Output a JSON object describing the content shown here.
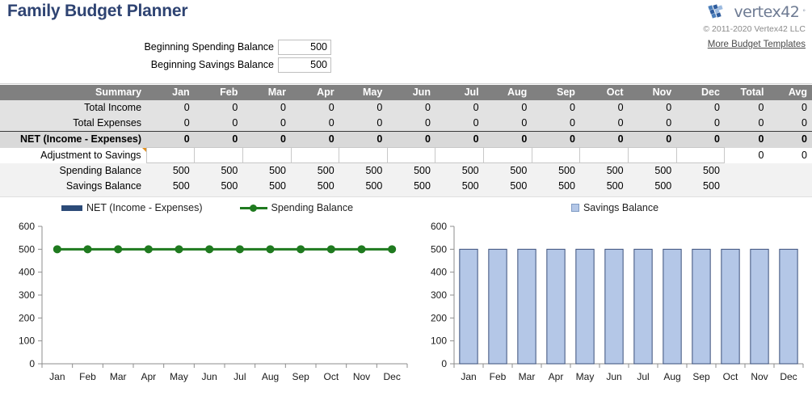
{
  "header": {
    "title": "Family Budget Planner",
    "brand_name": "vertex42",
    "brand_sup": "°",
    "logo_icon": "vertex42-logo-icon",
    "copyright": "© 2011-2020 Vertex42 LLC",
    "more_templates_link": "More Budget Templates"
  },
  "balances": {
    "rows": [
      {
        "label": "Beginning Spending Balance",
        "value": "500"
      },
      {
        "label": "Beginning Savings Balance",
        "value": "500"
      }
    ]
  },
  "summary": {
    "columns": [
      "Summary",
      "Jan",
      "Feb",
      "Mar",
      "Apr",
      "May",
      "Jun",
      "Jul",
      "Aug",
      "Sep",
      "Oct",
      "Nov",
      "Dec",
      "Total",
      "Avg"
    ],
    "rows": [
      {
        "label": "Total Income",
        "values": [
          "0",
          "0",
          "0",
          "0",
          "0",
          "0",
          "0",
          "0",
          "0",
          "0",
          "0",
          "0"
        ],
        "total": "0",
        "avg": "0"
      },
      {
        "label": "Total Expenses",
        "values": [
          "0",
          "0",
          "0",
          "0",
          "0",
          "0",
          "0",
          "0",
          "0",
          "0",
          "0",
          "0"
        ],
        "total": "0",
        "avg": "0"
      },
      {
        "label": "NET (Income - Expenses)",
        "values": [
          "0",
          "0",
          "0",
          "0",
          "0",
          "0",
          "0",
          "0",
          "0",
          "0",
          "0",
          "0"
        ],
        "total": "0",
        "avg": "0"
      },
      {
        "label": "Adjustment to Savings",
        "values": [
          "",
          "",
          "",
          "",
          "",
          "",
          "",
          "",
          "",
          "",
          "",
          ""
        ],
        "total": "0",
        "avg": "0"
      },
      {
        "label": "Spending Balance",
        "values": [
          "500",
          "500",
          "500",
          "500",
          "500",
          "500",
          "500",
          "500",
          "500",
          "500",
          "500",
          "500"
        ],
        "total": "",
        "avg": ""
      },
      {
        "label": "Savings Balance",
        "values": [
          "500",
          "500",
          "500",
          "500",
          "500",
          "500",
          "500",
          "500",
          "500",
          "500",
          "500",
          "500"
        ],
        "total": "",
        "avg": ""
      }
    ]
  },
  "colors": {
    "title": "#2e4372",
    "header_bg": "#808080",
    "net_bar": "#2c4b78",
    "spending_line": "#1f7a1f",
    "savings_bar_fill": "#b4c7e7",
    "savings_bar_border": "#3a4f7a"
  },
  "chart_data": [
    {
      "type": "bar",
      "id": "spending-chart",
      "title": "",
      "categories": [
        "Jan",
        "Feb",
        "Mar",
        "Apr",
        "May",
        "Jun",
        "Jul",
        "Aug",
        "Sep",
        "Oct",
        "Nov",
        "Dec"
      ],
      "series": [
        {
          "name": "NET (Income - Expenses)",
          "type": "bar",
          "color": "#2c4b78",
          "values": [
            0,
            0,
            0,
            0,
            0,
            0,
            0,
            0,
            0,
            0,
            0,
            0
          ]
        },
        {
          "name": "Spending Balance",
          "type": "line",
          "color": "#1f7a1f",
          "values": [
            500,
            500,
            500,
            500,
            500,
            500,
            500,
            500,
            500,
            500,
            500,
            500
          ]
        }
      ],
      "xlabel": "",
      "ylabel": "",
      "ylim": [
        0,
        600
      ],
      "yticks": [
        0,
        100,
        200,
        300,
        400,
        500,
        600
      ],
      "ytick_labels": [
        "0",
        "100",
        "200",
        "300",
        "400",
        "500",
        "600"
      ],
      "grid": false,
      "legend_position": "top"
    },
    {
      "type": "bar",
      "id": "savings-chart",
      "title": "",
      "categories": [
        "Jan",
        "Feb",
        "Mar",
        "Apr",
        "May",
        "Jun",
        "Jul",
        "Aug",
        "Sep",
        "Oct",
        "Nov",
        "Dec"
      ],
      "series": [
        {
          "name": "Savings Balance",
          "type": "bar",
          "color": "#b4c7e7",
          "values": [
            500,
            500,
            500,
            500,
            500,
            500,
            500,
            500,
            500,
            500,
            500,
            500
          ]
        }
      ],
      "xlabel": "",
      "ylabel": "",
      "ylim": [
        0,
        600
      ],
      "yticks": [
        0,
        100,
        200,
        300,
        400,
        500,
        600
      ],
      "ytick_labels": [
        "0",
        "100",
        "200",
        "300",
        "400",
        "500",
        "600"
      ],
      "grid": false,
      "legend_position": "top"
    }
  ]
}
